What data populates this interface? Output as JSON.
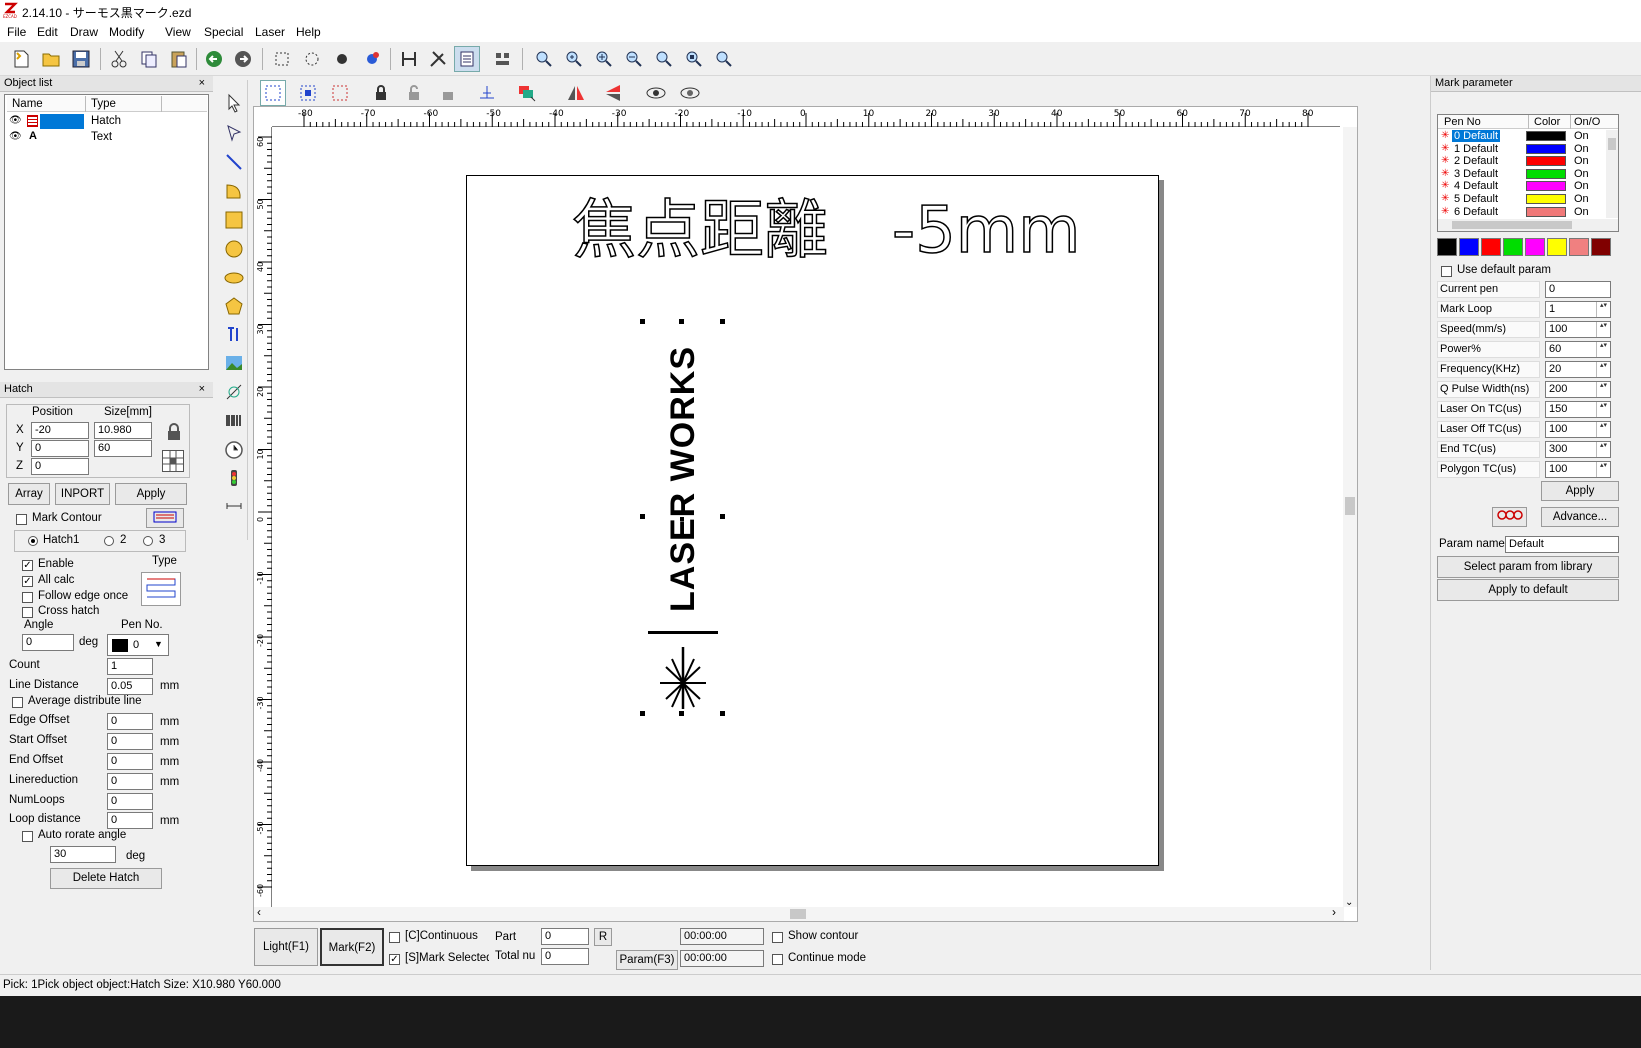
{
  "window": {
    "title": "2.14.10 - サーモス黒マーク.ezd",
    "app_icon_text": "EZCAD"
  },
  "menu": [
    "File",
    "Edit",
    "Draw",
    "Modify",
    "View",
    "Special",
    "Laser",
    "Help"
  ],
  "object_list": {
    "title": "Object list",
    "columns": [
      "Name",
      "Type"
    ],
    "rows": [
      {
        "type": "Hatch",
        "name_icon": "hatch-icon"
      },
      {
        "type": "Text",
        "name_icon": "text-A-icon",
        "name": "A"
      }
    ]
  },
  "hatch_panel": {
    "title": "Hatch",
    "position_label": "Position",
    "size_label": "Size[mm]",
    "x_label": "X",
    "y_label": "Y",
    "z_label": "Z",
    "x_pos": "-20",
    "x_size": "10.980",
    "y_pos": "0",
    "y_size": "60",
    "z_pos": "0",
    "array_btn": "Array",
    "inport_btn": "INPORT",
    "apply_btn": "Apply",
    "mark_contour": "Mark Contour",
    "hatch1": "Hatch1",
    "hatch2": "2",
    "hatch3": "3",
    "enable": "Enable",
    "type_label": "Type",
    "all_calc": "All calc",
    "follow_edge": "Follow edge once",
    "cross_hatch": "Cross hatch",
    "angle_label": "Angle",
    "pen_no_label": "Pen No.",
    "angle": "0",
    "deg": "deg",
    "pen_no": "0",
    "count_label": "Count",
    "count": "1",
    "line_distance_label": "Line Distance",
    "line_distance": "0.05",
    "mm": "mm",
    "avg_distribute": "Average distribute line",
    "edge_offset_label": "Edge Offset",
    "edge_offset": "0",
    "start_offset_label": "Start Offset",
    "start_offset": "0",
    "end_offset_label": "End Offset",
    "end_offset": "0",
    "linereduction_label": "Linereduction",
    "linereduction": "0",
    "numloops_label": "NumLoops",
    "numloops": "0",
    "loop_distance_label": "Loop distance",
    "loop_distance": "0",
    "auto_rotate": "Auto rorate angle",
    "rotate_angle": "30",
    "delete_hatch": "Delete Hatch"
  },
  "canvas": {
    "heading_text": "焦点距離　-5mm",
    "vertical_text": "LASER WORKS",
    "ruler_top": [
      "-80",
      "-70",
      "-60",
      "-50",
      "-40",
      "-30",
      "-20",
      "-10",
      "0",
      "10",
      "20",
      "30",
      "40",
      "50",
      "60",
      "70",
      "80"
    ],
    "ruler_left": [
      "60",
      "50",
      "40",
      "30",
      "20",
      "10",
      "0",
      "-10",
      "-20",
      "-30",
      "-40",
      "-50",
      "-60"
    ]
  },
  "bottom_bar": {
    "light_btn": "Light(F1)",
    "mark_btn": "Mark(F2)",
    "continuous": "[C]Continuous",
    "mark_selected": "[S]Mark Selected",
    "part_label": "Part",
    "part": "0",
    "r_btn": "R",
    "total_label": "Total nu",
    "total": "0",
    "time1": "00:00:00",
    "time2": "00:00:00",
    "param_btn": "Param(F3)",
    "show_contour": "Show contour",
    "continue_mode": "Continue mode"
  },
  "status": "Pick: 1Pick object object:Hatch Size: X10.980 Y60.000",
  "mark_param": {
    "title": "Mark parameter",
    "columns": [
      "Pen No",
      "Color",
      "On/O"
    ],
    "pens": [
      {
        "name": "0 Default",
        "color": "#000000",
        "on": "On"
      },
      {
        "name": "1 Default",
        "color": "#0000ff",
        "on": "On"
      },
      {
        "name": "2 Default",
        "color": "#ff0000",
        "on": "On"
      },
      {
        "name": "3 Default",
        "color": "#00dd00",
        "on": "On"
      },
      {
        "name": "4 Default",
        "color": "#ff00ff",
        "on": "On"
      },
      {
        "name": "5 Default",
        "color": "#ffff00",
        "on": "On"
      },
      {
        "name": "6 Default",
        "color": "#f07878",
        "on": "On"
      }
    ],
    "palette": [
      "#000000",
      "#0000ff",
      "#ff0000",
      "#00dd00",
      "#ff00ff",
      "#ffff00",
      "#f08080",
      "#800000"
    ],
    "use_default": "Use default param",
    "params": [
      {
        "label": "Current pen",
        "value": "0",
        "spin": false
      },
      {
        "label": "Mark Loop",
        "value": "1",
        "spin": true
      },
      {
        "label": "Speed(mm/s)",
        "value": "100",
        "spin": true
      },
      {
        "label": "Power%",
        "value": "60",
        "spin": true
      },
      {
        "label": "Frequency(KHz)",
        "value": "20",
        "spin": true
      },
      {
        "label": "Q Pulse Width(ns)",
        "value": "200",
        "spin": true
      },
      {
        "label": "Laser On TC(us)",
        "value": "150",
        "spin": true
      },
      {
        "label": "Laser Off TC(us)",
        "value": "100",
        "spin": true
      },
      {
        "label": "End TC(us)",
        "value": "300",
        "spin": true
      },
      {
        "label": "Polygon TC(us)",
        "value": "100",
        "spin": true
      }
    ],
    "apply_btn": "Apply",
    "advance_btn": "Advance...",
    "param_name_label": "Param name",
    "param_name": "Default",
    "select_lib_btn": "Select param from library",
    "apply_default_btn": "Apply to default"
  }
}
